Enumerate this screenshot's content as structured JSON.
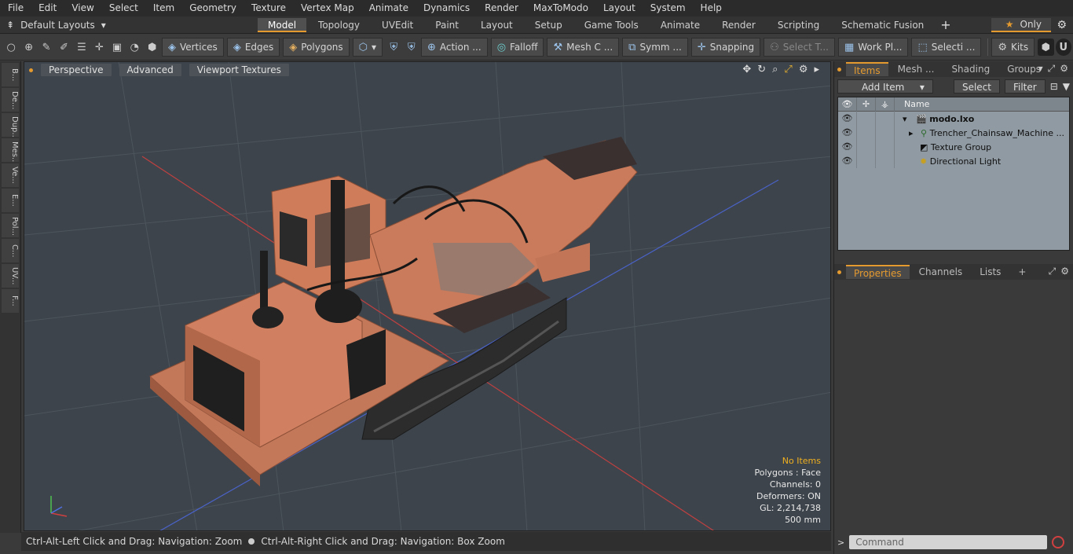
{
  "menu": [
    "File",
    "Edit",
    "View",
    "Select",
    "Item",
    "Geometry",
    "Texture",
    "Vertex Map",
    "Animate",
    "Dynamics",
    "Render",
    "MaxToModo",
    "Layout",
    "System",
    "Help"
  ],
  "layout_selector": "Default Layouts",
  "tabs": [
    "Model",
    "Topology",
    "UVEdit",
    "Paint",
    "Layout",
    "Setup",
    "Game Tools",
    "Animate",
    "Render",
    "Scripting",
    "Schematic Fusion"
  ],
  "active_tab": "Model",
  "only_label": "Only",
  "toolbar": {
    "vertices": "Vertices",
    "edges": "Edges",
    "polygons": "Polygons",
    "action": "Action ...",
    "falloff": "Falloff",
    "mesh": "Mesh C ...",
    "symmetry": "Symm ...",
    "snapping": "Snapping",
    "select_t": "Select T...",
    "work_plane": "Work Pl...",
    "selection": "Selecti ...",
    "kits": "Kits"
  },
  "left_tabs": [
    "B...",
    "De...",
    "Dup...",
    "Mes...",
    "Ve...",
    "E...",
    "Pol...",
    "C...",
    "UV...",
    "F..."
  ],
  "viewport": {
    "perspective": "Perspective",
    "advanced": "Advanced",
    "textures": "Viewport Textures",
    "info": {
      "no_items": "No Items",
      "polygons": "Polygons : Face",
      "channels": "Channels: 0",
      "deformers": "Deformers: ON",
      "gl": "GL: 2,214,738",
      "scale": "500 mm"
    }
  },
  "status": {
    "left": "Ctrl-Alt-Left Click and Drag: Navigation: Zoom",
    "right": "Ctrl-Alt-Right Click and Drag: Navigation: Box Zoom"
  },
  "items_panel": {
    "tabs": [
      "Items",
      "Mesh ...",
      "Shading",
      "Groups"
    ],
    "add_item": "Add Item",
    "select": "Select",
    "filter": "Filter",
    "name_header": "Name",
    "tree": [
      {
        "label": "modo.lxo",
        "bold": true
      },
      {
        "label": "Trencher_Chainsaw_Machine ...",
        "bold": false
      },
      {
        "label": "Texture Group",
        "bold": false
      },
      {
        "label": "Directional Light",
        "bold": false
      }
    ]
  },
  "props_panel": {
    "tabs": [
      "Properties",
      "Channels",
      "Lists"
    ]
  },
  "command": {
    "placeholder": "Command"
  },
  "colors": {
    "accent": "#e59a2f",
    "machine": "#c8785a",
    "viewport_bg": "#3d444b"
  }
}
